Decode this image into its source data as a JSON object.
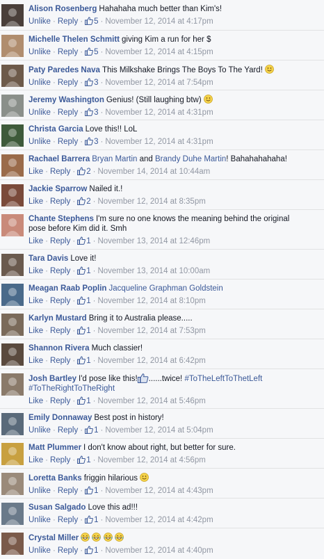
{
  "comments": [
    {
      "author": "Alison Rosenberg",
      "text": "Hahahaha much better than Kim's!",
      "action": "Unlike",
      "reply": "Reply",
      "likes": "5",
      "time": "November 12, 2014 at 4:17pm",
      "avatar_color": "#4a3f3a"
    },
    {
      "author": "Michelle Thelen Schmitt",
      "text": "giving Kim a run for her $",
      "action": "Unlike",
      "reply": "Reply",
      "likes": "5",
      "time": "November 12, 2014 at 4:15pm",
      "avatar_color": "#b08d6e"
    },
    {
      "author": "Paty Paredes Nava",
      "text": "This Milkshake Brings The Boys To The Yard!",
      "emoji": "smile",
      "action": "Unlike",
      "reply": "Reply",
      "likes": "3",
      "time": "November 12, 2014 at 7:54pm",
      "avatar_color": "#6d5a4a"
    },
    {
      "author": "Jeremy Washington",
      "text": "Genius! (Still laughing btw)",
      "emoji": "smile",
      "action": "Unlike",
      "reply": "Reply",
      "likes": "3",
      "time": "November 12, 2014 at 4:31pm",
      "avatar_color": "#8a8f8a"
    },
    {
      "author": "Christa Garcia",
      "text": "Love this!! LoL",
      "action": "Unlike",
      "reply": "Reply",
      "likes": "3",
      "time": "November 12, 2014 at 4:31pm",
      "avatar_color": "#3e5a3a"
    },
    {
      "author": "Rachael Barrera",
      "mentions": [
        "Bryan Martin",
        "Brandy Duhe Martin"
      ],
      "mention_join": "and",
      "text": "! Bahahahahaha!",
      "action": "Like",
      "reply": "Reply",
      "likes": "2",
      "time": "November 14, 2014 at 10:44am",
      "avatar_color": "#9a6b4a"
    },
    {
      "author": "Jackie Sparrow",
      "text": "Nailed it.!",
      "action": "Like",
      "reply": "Reply",
      "likes": "2",
      "time": "November 12, 2014 at 8:35pm",
      "avatar_color": "#7a4a3a"
    },
    {
      "author": "Chante Stephens",
      "text": "I'm sure no one knows the meaning behind the original",
      "text2": "pose before Kim did it. Smh",
      "action": "Like",
      "reply": "Reply",
      "likes": "1",
      "time": "November 13, 2014 at 12:46pm",
      "avatar_color": "#c98a7a"
    },
    {
      "author": "Tara Davis",
      "text": "Love it!",
      "action": "Like",
      "reply": "Reply",
      "likes": "1",
      "time": "November 13, 2014 at 10:00am",
      "avatar_color": "#6a5a4e"
    },
    {
      "author": "Meagan Raab Poplin",
      "mentions": [
        "Jacqueline Graphman Goldstein"
      ],
      "text": "",
      "action": "Like",
      "reply": "Reply",
      "likes": "1",
      "time": "November 12, 2014 at 8:10pm",
      "avatar_color": "#4a6a8a"
    },
    {
      "author": "Karlyn Mustard",
      "text": "Bring it to Australia please.....",
      "action": "Like",
      "reply": "Reply",
      "likes": "1",
      "time": "November 12, 2014 at 7:53pm",
      "avatar_color": "#7a6a5a"
    },
    {
      "author": "Shannon Rivera",
      "text": "Much classier!",
      "action": "Like",
      "reply": "Reply",
      "likes": "1",
      "time": "November 12, 2014 at 6:42pm",
      "avatar_color": "#5a4a3e"
    },
    {
      "author": "Josh Bartley",
      "text": "I'd pose like this!",
      "text_after_thumb": "......twice!",
      "hashtags": [
        "#ToTheLeftToThetLeft",
        "#ToTheRightToTheRight"
      ],
      "action": "Like",
      "reply": "Reply",
      "likes": "1",
      "time": "November 12, 2014 at 5:46pm",
      "avatar_color": "#8a7a6a"
    },
    {
      "author": "Emily Donnaway",
      "text": "Best post in history!",
      "action": "Unlike",
      "reply": "Reply",
      "likes": "1",
      "time": "November 12, 2014 at 5:04pm",
      "avatar_color": "#5a6a7a"
    },
    {
      "author": "Matt Plummer",
      "text": "I don't know about right, but better for sure.",
      "action": "Like",
      "reply": "Reply",
      "likes": "1",
      "time": "November 12, 2014 at 4:56pm",
      "avatar_color": "#c8a040"
    },
    {
      "author": "Loretta Banks",
      "text": "friggin hilarious",
      "emoji": "smile",
      "action": "Unlike",
      "reply": "Reply",
      "likes": "1",
      "time": "November 12, 2014 at 4:43pm",
      "avatar_color": "#9a8a7a"
    },
    {
      "author": "Susan Salgado",
      "text": "Love this ad!!!",
      "action": "Unlike",
      "reply": "Reply",
      "likes": "1",
      "time": "November 12, 2014 at 4:42pm",
      "avatar_color": "#6a7a8a"
    },
    {
      "author": "Crystal Miller",
      "text": "",
      "emoji": "laugh",
      "emoji_count": 4,
      "action": "Unlike",
      "reply": "Reply",
      "likes": "1",
      "time": "November 12, 2014 at 4:40pm",
      "avatar_color": "#7a5a4a"
    }
  ]
}
